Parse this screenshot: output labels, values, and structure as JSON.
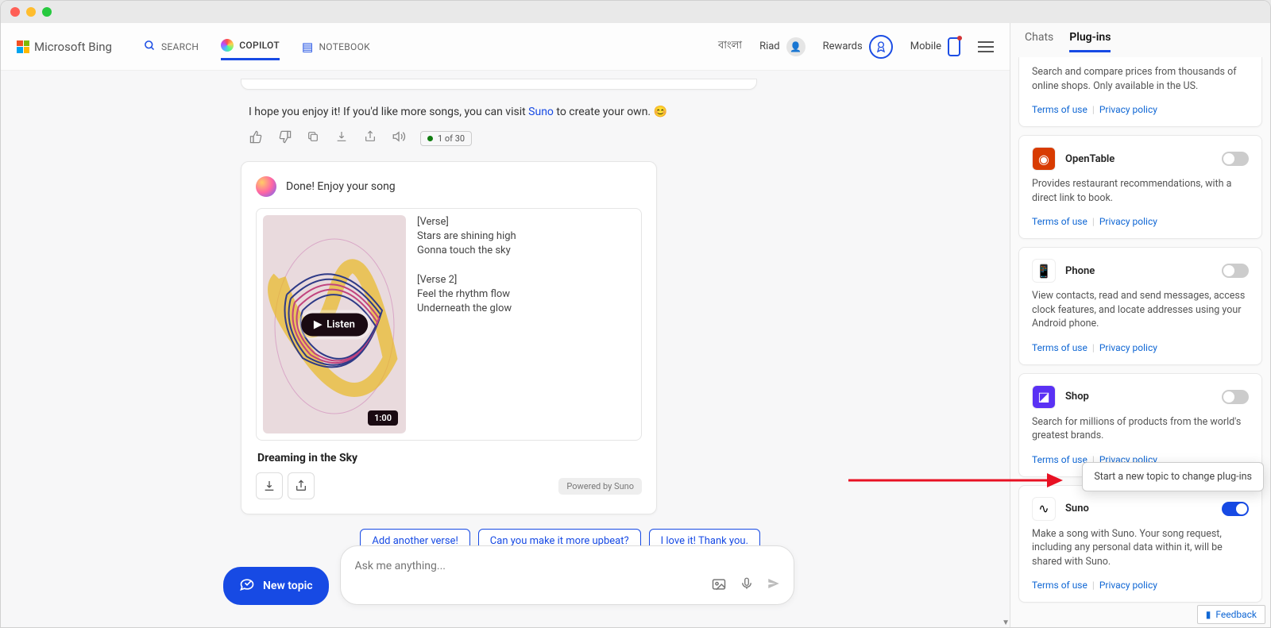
{
  "header": {
    "logo_text": "Microsoft Bing",
    "tabs": {
      "search": "SEARCH",
      "copilot": "COPILOT",
      "notebook": "NOTEBOOK"
    },
    "right": {
      "language": "বাংলা",
      "user": "Riad",
      "rewards": "Rewards",
      "mobile": "Mobile"
    }
  },
  "chat": {
    "msg_prefix": "I hope you enjoy it! If you'd like more songs, you can visit ",
    "msg_link": "Suno",
    "msg_suffix": " to create your own. 😊",
    "counter": "1 of 30",
    "card": {
      "header": "Done! Enjoy your song",
      "listen": "Listen",
      "duration": "1:00",
      "lyrics": "[Verse]\nStars are shining high\nGonna touch the sky\n\n[Verse 2]\nFeel the rhythm flow\nUnderneath the glow",
      "title": "Dreaming in the Sky",
      "powered": "Powered by Suno"
    },
    "suggestions": [
      "Add another verse!",
      "Can you make it more upbeat?",
      "I love it! Thank you."
    ]
  },
  "composer": {
    "new_topic": "New topic",
    "placeholder": "Ask me anything..."
  },
  "sidebar": {
    "tabs": {
      "chats": "Chats",
      "plugins": "Plug-ins"
    },
    "truncated_desc": "Search and compare prices from thousands of online shops. Only available in the US.",
    "terms": "Terms of use",
    "privacy": "Privacy policy",
    "plugins": [
      {
        "name": "OpenTable",
        "desc": "Provides restaurant recommendations, with a direct link to book.",
        "icon_bg": "#d83b01",
        "icon_fg": "#fff",
        "glyph": "◉",
        "on": false
      },
      {
        "name": "Phone",
        "desc": "View contacts, read and send messages, access clock features, and locate addresses using your Android phone.",
        "icon_bg": "#fff",
        "icon_fg": "#1b4de4",
        "glyph": "📱",
        "on": false
      },
      {
        "name": "Shop",
        "desc": "Search for millions of products from the world's greatest brands.",
        "icon_bg": "#5a31f4",
        "icon_fg": "#fff",
        "glyph": "◪",
        "on": false
      },
      {
        "name": "Suno",
        "desc": "Make a song with Suno. Your song request, including any personal data within it, will be shared with Suno.",
        "icon_bg": "#fff",
        "icon_fg": "#000",
        "glyph": "∿",
        "on": true
      }
    ],
    "tooltip": "Start a new topic to change plug-ins",
    "feedback": "Feedback"
  }
}
